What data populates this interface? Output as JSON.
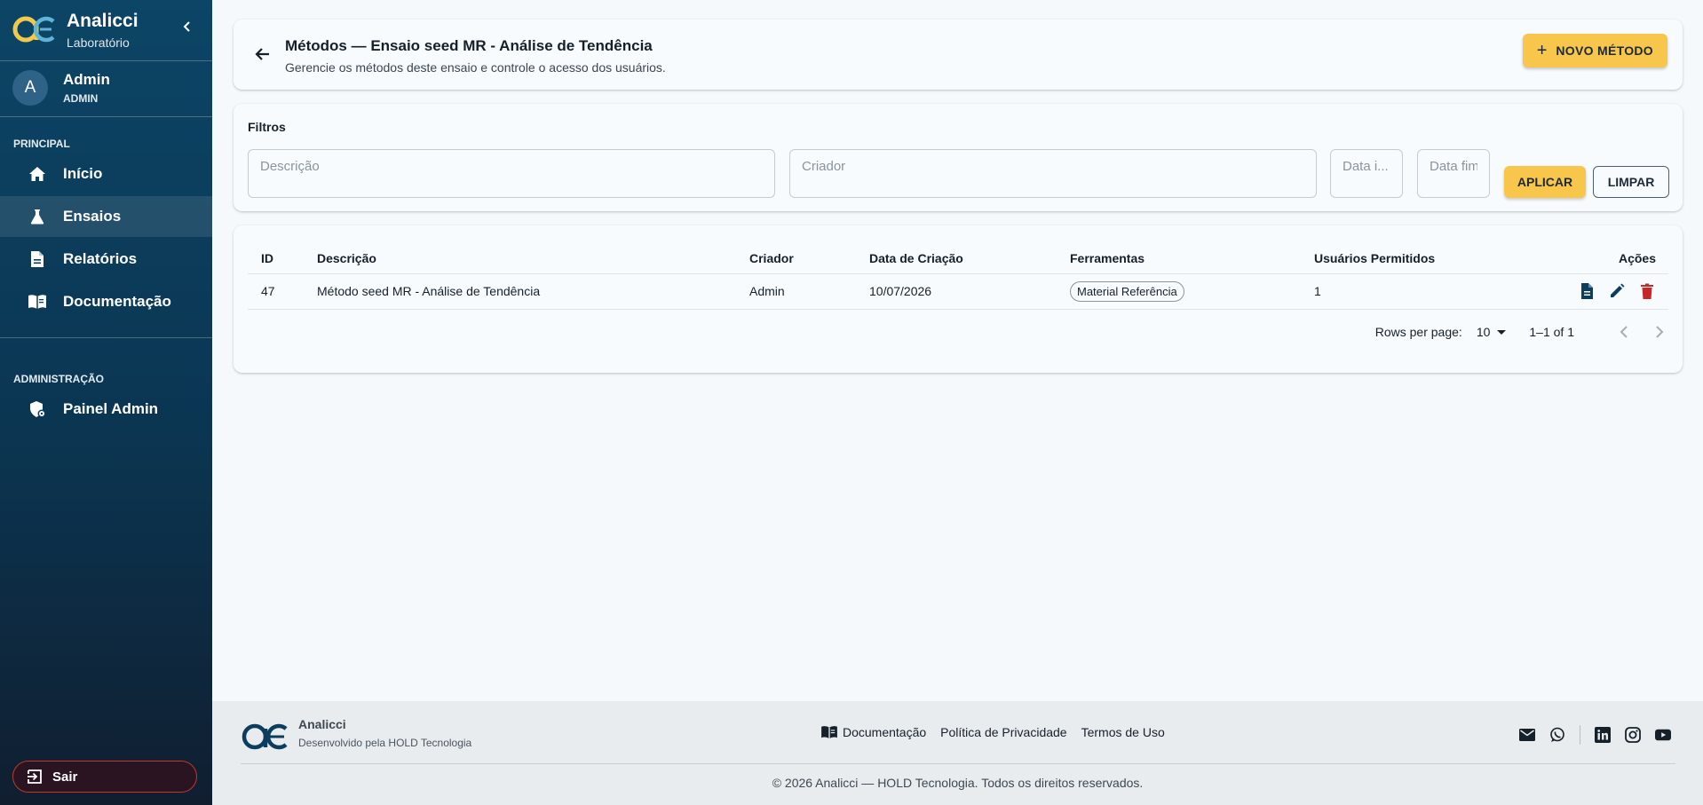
{
  "sidebar": {
    "brand_name": "Analicci",
    "brand_sub": "Laboratório",
    "user": {
      "initial": "A",
      "name": "Admin",
      "role": "ADMIN"
    },
    "section_principal": "PRINCIPAL",
    "items": [
      {
        "label": "Início",
        "icon": "home-icon"
      },
      {
        "label": "Ensaios",
        "icon": "flask-icon",
        "active": true
      },
      {
        "label": "Relatórios",
        "icon": "report-icon"
      },
      {
        "label": "Documentação",
        "icon": "book-icon"
      }
    ],
    "section_admin": "ADMINISTRAÇÃO",
    "admin_items": [
      {
        "label": "Painel Admin",
        "icon": "shield-gear-icon"
      }
    ],
    "logout_label": "Sair"
  },
  "header": {
    "title": "Métodos — Ensaio seed MR - Análise de Tendência",
    "subtitle": "Gerencie os métodos deste ensaio e controle o acesso dos usuários.",
    "new_button": "NOVO MÉTODO"
  },
  "filters": {
    "title": "Filtros",
    "descricao_placeholder": "Descrição",
    "criador_placeholder": "Criador",
    "data_inicio_placeholder": "Data i...",
    "data_fim_placeholder": "Data fim",
    "apply_label": "APLICAR",
    "clear_label": "LIMPAR"
  },
  "table": {
    "columns": [
      "ID",
      "Descrição",
      "Criador",
      "Data de Criação",
      "Ferramentas",
      "Usuários Permitidos",
      "Ações"
    ],
    "rows": [
      {
        "id": "47",
        "descricao": "Método seed MR - Análise de Tendência",
        "criador": "Admin",
        "data": "10/07/2026",
        "ferramenta": "Material Referência",
        "usuarios": "1"
      }
    ],
    "pagination": {
      "rows_per_page_label": "Rows per page:",
      "rows_per_page": "10",
      "range": "1–1 of 1"
    }
  },
  "footer": {
    "name": "Analicci",
    "developer": "Desenvolvido pela HOLD Tecnologia",
    "links": [
      "Documentação",
      "Política de Privacidade",
      "Termos de Uso"
    ],
    "copyright": "© 2026 Analicci — HOLD Tecnologia. Todos os direitos reservados."
  },
  "colors": {
    "accent": "#f7c64b",
    "sidebar": "#0c4566",
    "danger": "#c62828",
    "action_blue": "#0b3d5e"
  }
}
